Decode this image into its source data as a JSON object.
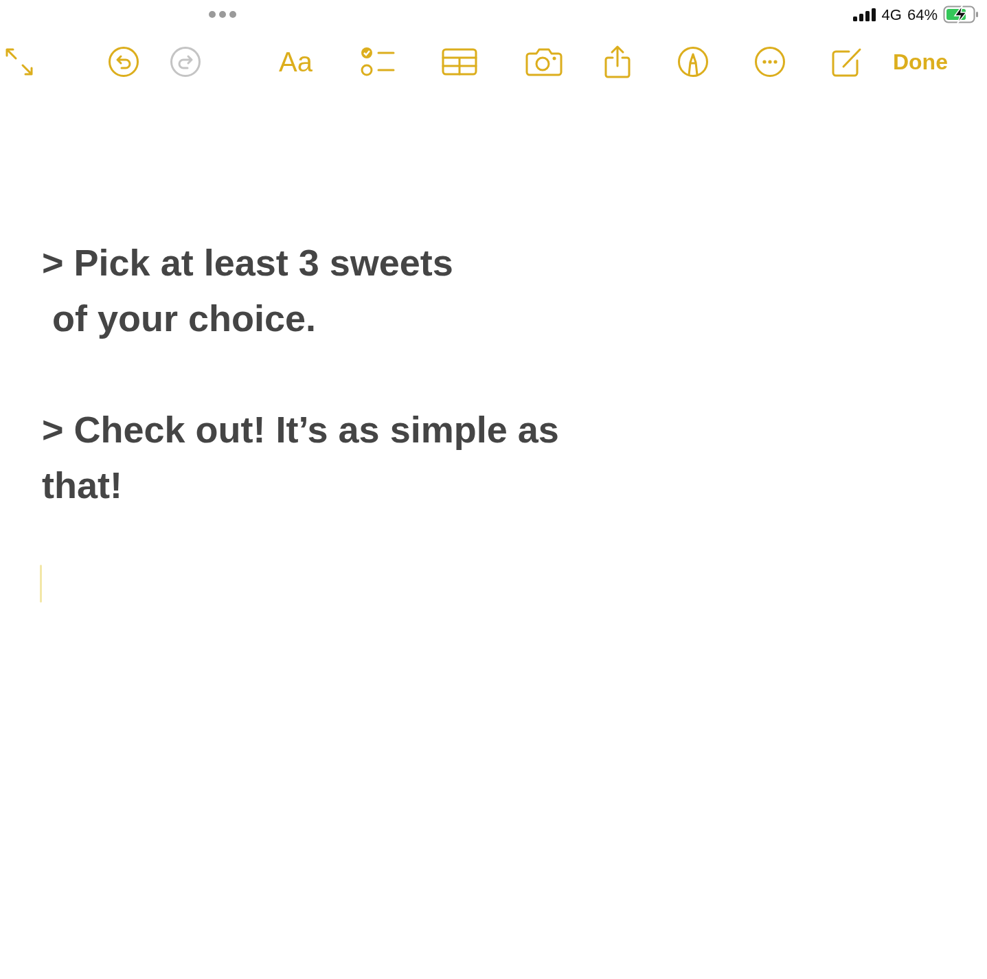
{
  "status_bar": {
    "network": "4G",
    "battery": "64%",
    "charging": true
  },
  "toolbar": [
    {
      "kind": "resize",
      "disabled": false
    },
    {
      "kind": "undo",
      "disabled": false
    },
    {
      "kind": "redo",
      "disabled": true
    },
    {
      "kind": "format",
      "label": "Aa",
      "disabled": false
    },
    {
      "kind": "checklist",
      "disabled": false
    },
    {
      "kind": "table",
      "disabled": false
    },
    {
      "kind": "camera",
      "disabled": false
    },
    {
      "kind": "share",
      "disabled": false
    },
    {
      "kind": "markup",
      "disabled": false
    },
    {
      "kind": "more",
      "disabled": false
    },
    {
      "kind": "compose",
      "disabled": false
    },
    {
      "kind": "done",
      "label": "Done",
      "disabled": false
    }
  ],
  "note": {
    "paragraphs": [
      [
        "> Pick at least 3 sweets",
        " of your choice."
      ],
      [
        "> Check out! It’s as simple as",
        "that!"
      ]
    ]
  }
}
